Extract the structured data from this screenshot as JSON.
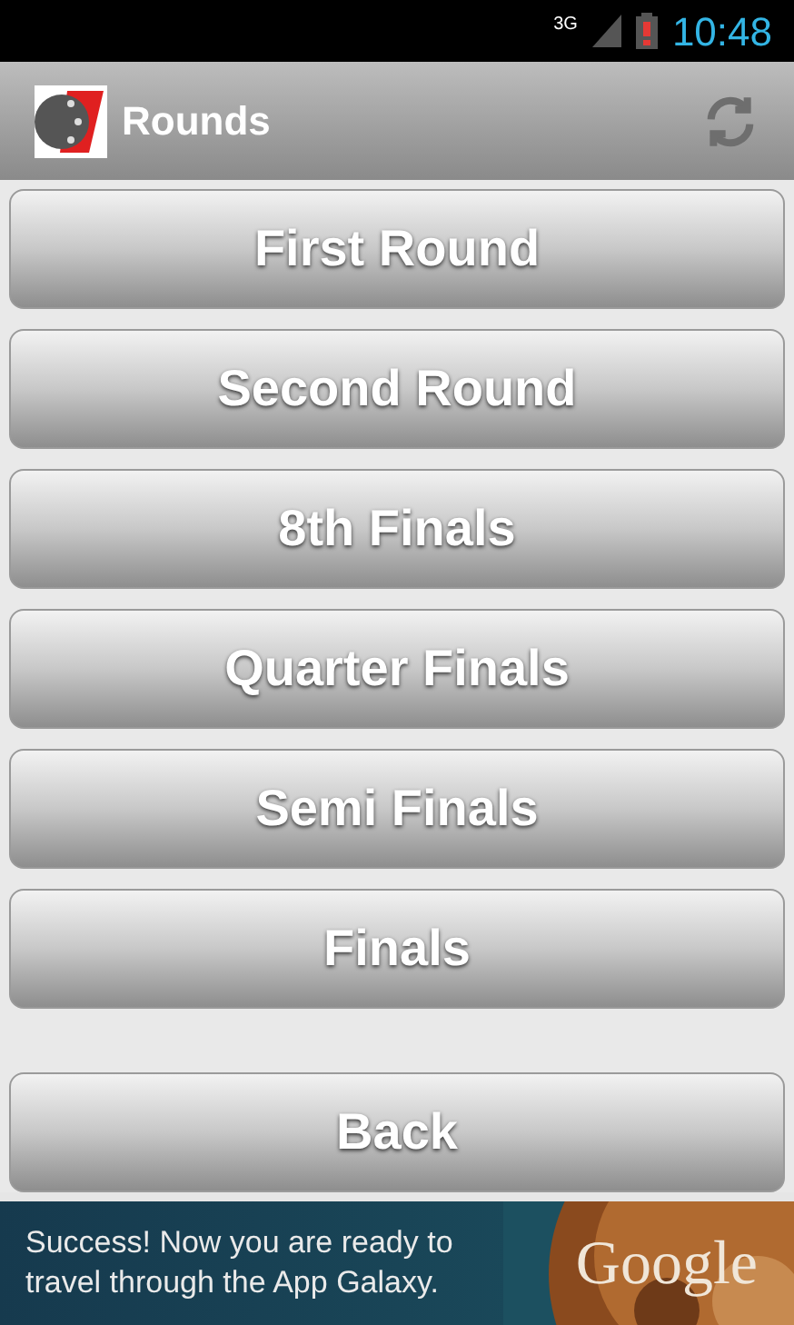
{
  "status_bar": {
    "network": "3G",
    "time": "10:48"
  },
  "action_bar": {
    "title": "Rounds"
  },
  "rounds": [
    {
      "label": "First Round"
    },
    {
      "label": "Second Round"
    },
    {
      "label": "8th Finals"
    },
    {
      "label": "Quarter Finals"
    },
    {
      "label": "Semi Finals"
    },
    {
      "label": "Finals"
    }
  ],
  "back_button": {
    "label": "Back"
  },
  "ad_banner": {
    "text": "Success! Now you are ready to travel through the App Galaxy.",
    "brand": "Google"
  }
}
